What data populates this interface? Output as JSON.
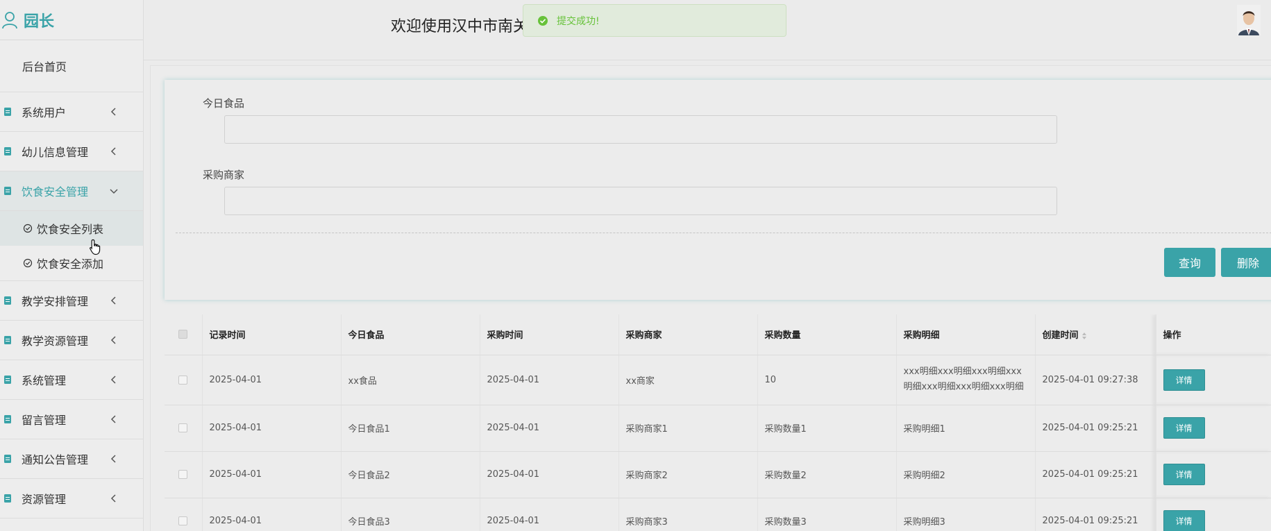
{
  "brand": {
    "title": "园长"
  },
  "header": {
    "title": "欢迎使用汉中市南关",
    "toast": "提交成功!"
  },
  "sidebar": {
    "home": "后台首页",
    "items": [
      {
        "label": "系统用户"
      },
      {
        "label": "幼儿信息管理"
      },
      {
        "label": "饮食安全管理",
        "active": true,
        "children": [
          "饮食安全列表",
          "饮食安全添加"
        ]
      },
      {
        "label": "教学安排管理"
      },
      {
        "label": "教学资源管理"
      },
      {
        "label": "系统管理"
      },
      {
        "label": "留言管理"
      },
      {
        "label": "通知公告管理"
      },
      {
        "label": "资源管理"
      }
    ]
  },
  "search": {
    "food_label": "今日食品",
    "food_value": "",
    "merchant_label": "采购商家",
    "merchant_value": "",
    "query_button": "查询",
    "delete_button": "删除"
  },
  "table": {
    "headers": [
      "记录时间",
      "今日食品",
      "采购时间",
      "采购商家",
      "采购数量",
      "采购明细",
      "创建时间",
      "操作"
    ],
    "detail_button": "详情",
    "rows": [
      [
        "2025-04-01",
        "xx食品",
        "2025-04-01",
        "xx商家",
        "10",
        "xxx明细xxx明细xxx明细xxx明细xxx明细xxx明细xxx明细",
        "2025-04-01 09:27:38"
      ],
      [
        "2025-04-01",
        "今日食品1",
        "2025-04-01",
        "采购商家1",
        "采购数量1",
        "采购明细1",
        "2025-04-01 09:25:21"
      ],
      [
        "2025-04-01",
        "今日食品2",
        "2025-04-01",
        "采购商家2",
        "采购数量2",
        "采购明细2",
        "2025-04-01 09:25:21"
      ],
      [
        "2025-04-01",
        "今日食品3",
        "2025-04-01",
        "采购商家3",
        "采购数量3",
        "采购明细3",
        "2025-04-01 09:25:21"
      ]
    ]
  },
  "colors": {
    "accent": "#3aa3a8",
    "success": "#67c23a"
  }
}
